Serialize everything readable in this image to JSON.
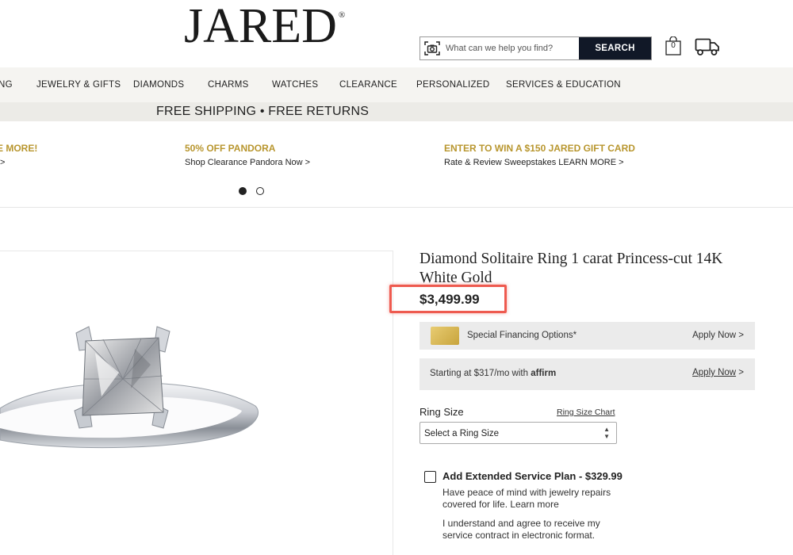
{
  "header": {
    "logo_text": "JARED",
    "search_placeholder": "What can we help you find?",
    "search_button": "SEARCH",
    "cart_count": "0"
  },
  "nav": {
    "items": [
      "NG",
      "JEWELRY & GIFTS",
      "DIAMONDS",
      "CHARMS",
      "WATCHES",
      "CLEARANCE",
      "PERSONALIZED",
      "SERVICES & EDUCATION"
    ]
  },
  "shipping_banner": "FREE SHIPPING • FREE RETURNS",
  "promos": [
    {
      "title": "E MORE!",
      "sub": ">"
    },
    {
      "title": "50% OFF PANDORA",
      "sub": "Shop Clearance Pandora Now >"
    },
    {
      "title": "ENTER TO WIN A $150 JARED GIFT CARD",
      "sub": "Rate & Review Sweepstakes LEARN MORE >"
    }
  ],
  "carousel": {
    "active_index": 0,
    "count": 2
  },
  "product": {
    "title": "Diamond Solitaire Ring 1 carat Princess-cut 14K White Gold",
    "price": "$3,499.99",
    "financing": {
      "label": "Special Financing Options*",
      "link": "Apply Now",
      "link_arrow": ">"
    },
    "affirm": {
      "text_prefix": "Starting at $317/mo with",
      "brand": "affirm",
      "link": "Apply Now",
      "link_arrow": ">"
    },
    "ring_size": {
      "label": "Ring Size",
      "chart_link": "Ring Size Chart",
      "select_value": "Select a Ring Size"
    },
    "service_plan": {
      "title": "Add Extended Service Plan - $329.99",
      "description": "Have peace of mind with jewelry repairs covered for life.  Learn more",
      "agreement": "I understand and agree to receive my service contract in electronic format."
    }
  },
  "colors": {
    "accent_gold": "#b8962e",
    "highlight_red": "#ee5a4f",
    "search_button_bg": "#111827"
  }
}
